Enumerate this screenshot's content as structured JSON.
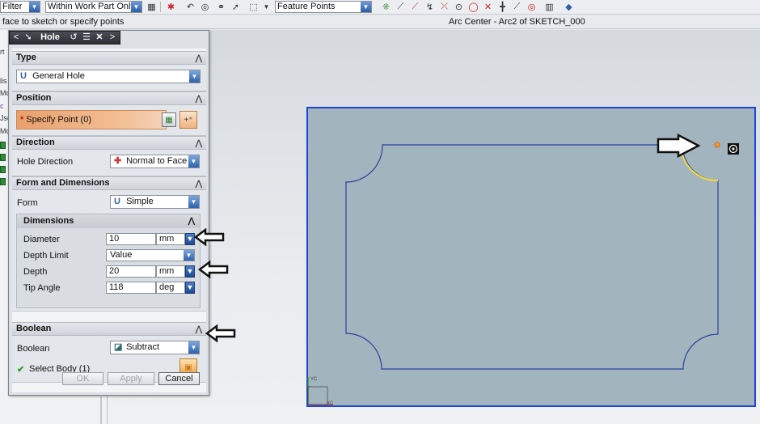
{
  "toolbar": {
    "filter_value": "Filter",
    "scope_value": "Within Work Part Only",
    "snap_value": "Feature Points"
  },
  "cue": {
    "prompt": "face to sketch or specify points",
    "status": "Arc Center - Arc2 of SKETCH_000"
  },
  "left_strip": {
    "partial_labels": [
      "rt",
      "lis",
      "Mo",
      "c",
      "Jse",
      "Mo"
    ]
  },
  "dialog": {
    "title": "Hole",
    "sections": {
      "type": {
        "header": "Type",
        "value": "General Hole"
      },
      "position": {
        "header": "Position",
        "specify_point": "Specify Point (0)"
      },
      "direction": {
        "header": "Direction",
        "label": "Hole Direction",
        "value": "Normal to Face"
      },
      "form_dims": {
        "header": "Form and Dimensions",
        "form_label": "Form",
        "form_value": "Simple",
        "dims_header": "Dimensions",
        "diameter_label": "Diameter",
        "diameter_value": "10",
        "diameter_unit": "mm",
        "depth_limit_label": "Depth Limit",
        "depth_limit_value": "Value",
        "depth_label": "Depth",
        "depth_value": "20",
        "depth_unit": "mm",
        "tip_angle_label": "Tip Angle",
        "tip_angle_value": "118",
        "tip_angle_unit": "deg"
      },
      "boolean": {
        "header": "Boolean",
        "label": "Boolean",
        "value": "Subtract",
        "select_body": "Select Body (1)"
      }
    },
    "buttons": {
      "ok": "OK",
      "apply": "Apply",
      "cancel": "Cancel"
    }
  },
  "graphics": {
    "axis_y_label": "YC",
    "axis_x_label": "XC"
  },
  "colors": {
    "sketch_plane_fill": "#a2b4bd",
    "sketch_plane_border": "#1f44d8",
    "profile_line": "#2a3fa0",
    "highlight_arc": "#f2d83c",
    "specify_point_bg": "#eba776"
  }
}
